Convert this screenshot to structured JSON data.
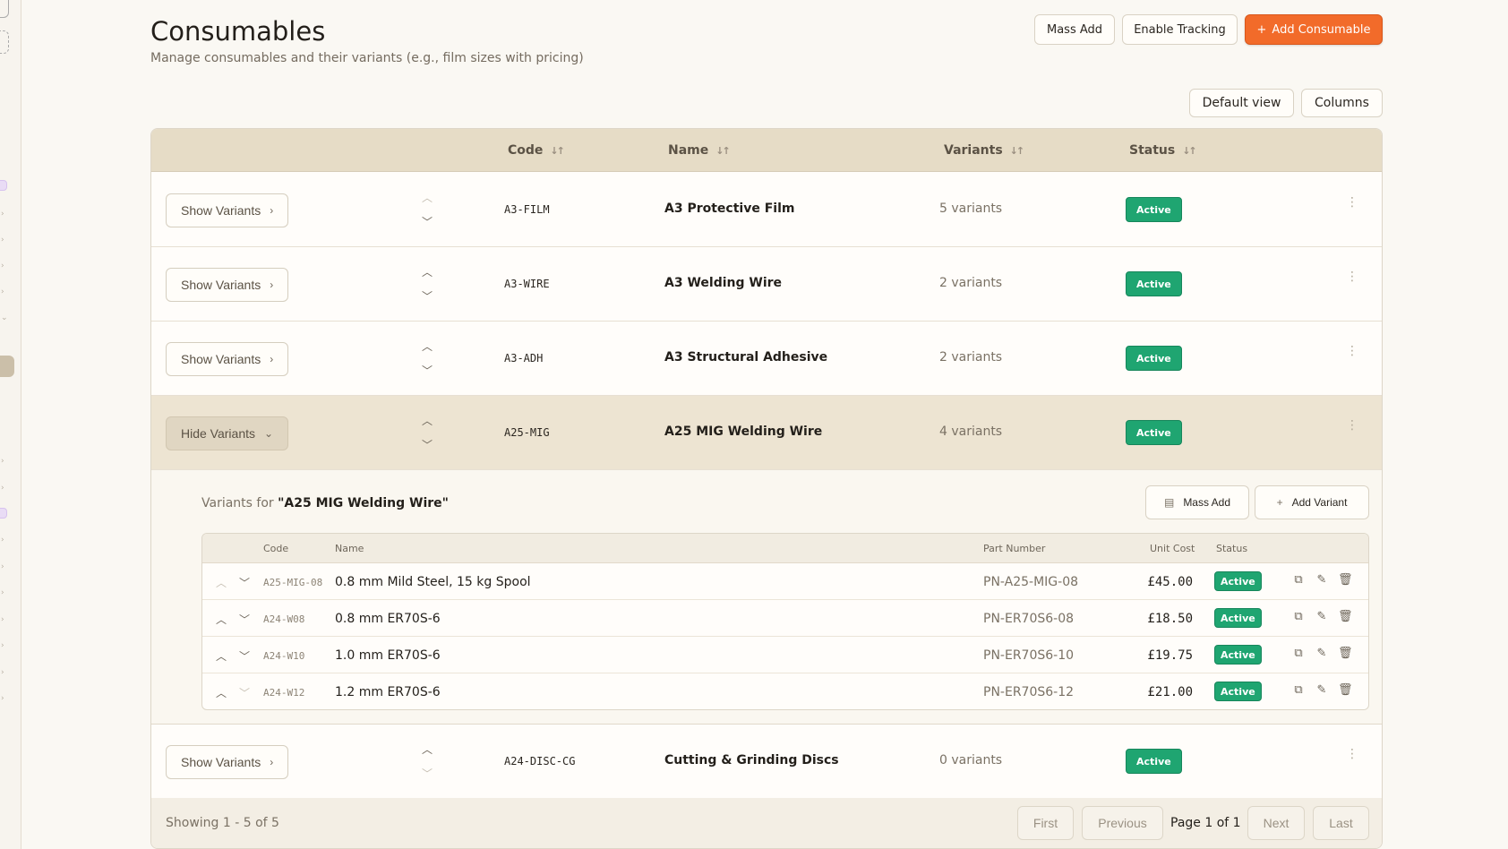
{
  "header": {
    "title": "Consumables",
    "subtitle": "Manage consumables and their variants (e.g., film sizes with pricing)",
    "mass_add_label": "Mass Add",
    "enable_tracking_label": "Enable Tracking",
    "add_consumable_label": "Add Consumable"
  },
  "toolbar": {
    "default_view_label": "Default view",
    "columns_label": "Columns"
  },
  "table": {
    "columns": [
      "Code",
      "Name",
      "Variants",
      "Status"
    ],
    "rows": [
      {
        "toggle_label": "Show Variants",
        "code": "A3-FILM",
        "name": "A3 Protective Film",
        "variants": "5 variants",
        "status": "Active"
      },
      {
        "toggle_label": "Show Variants",
        "code": "A3-WIRE",
        "name": "A3 Welding Wire",
        "variants": "2 variants",
        "status": "Active"
      },
      {
        "toggle_label": "Show Variants",
        "code": "A3-ADH",
        "name": "A3 Structural Adhesive",
        "variants": "2 variants",
        "status": "Active"
      },
      {
        "toggle_label": "Hide Variants",
        "code": "A25-MIG",
        "name": "A25 MIG Welding Wire",
        "variants": "4 variants",
        "status": "Active"
      },
      {
        "toggle_label": "Show Variants",
        "code": "A24-DISC-CG",
        "name": "Cutting & Grinding Discs",
        "variants": "0 variants",
        "status": "Active"
      }
    ]
  },
  "variants_panel": {
    "title_prefix": "Variants for ",
    "title_name": "\"A25 MIG Welding Wire\"",
    "mass_add_label": "Mass Add",
    "add_variant_label": "Add Variant",
    "columns": [
      "Code",
      "Name",
      "Part Number",
      "Unit Cost",
      "Status"
    ],
    "rows": [
      {
        "code": "A25-MIG-08",
        "name": "0.8 mm Mild Steel, 15 kg Spool",
        "part_number": "PN-A25-MIG-08",
        "unit_cost": "£45.00",
        "status": "Active"
      },
      {
        "code": "A24-W08",
        "name": "0.8 mm ER70S-6",
        "part_number": "PN-ER70S6-08",
        "unit_cost": "£18.50",
        "status": "Active"
      },
      {
        "code": "A24-W10",
        "name": "1.0 mm ER70S-6",
        "part_number": "PN-ER70S6-10",
        "unit_cost": "£19.75",
        "status": "Active"
      },
      {
        "code": "A24-W12",
        "name": "1.2 mm ER70S-6",
        "part_number": "PN-ER70S6-12",
        "unit_cost": "£21.00",
        "status": "Active"
      }
    ]
  },
  "pagination": {
    "showing": "Showing 1 - 5 of 5",
    "first": "First",
    "previous": "Previous",
    "page_info": "Page 1 of 1",
    "next": "Next",
    "last": "Last"
  },
  "colors": {
    "accent": "#f26b2a",
    "status_active": "#1fa571",
    "header_bg": "#e6dcc6"
  },
  "icons": [
    "plus-icon",
    "sort-icon",
    "chevron-right-icon",
    "chevron-down-icon",
    "arrow-up-icon",
    "arrow-down-icon",
    "kebab-menu-icon",
    "copy-icon",
    "edit-icon",
    "trash-icon",
    "list-icon"
  ]
}
